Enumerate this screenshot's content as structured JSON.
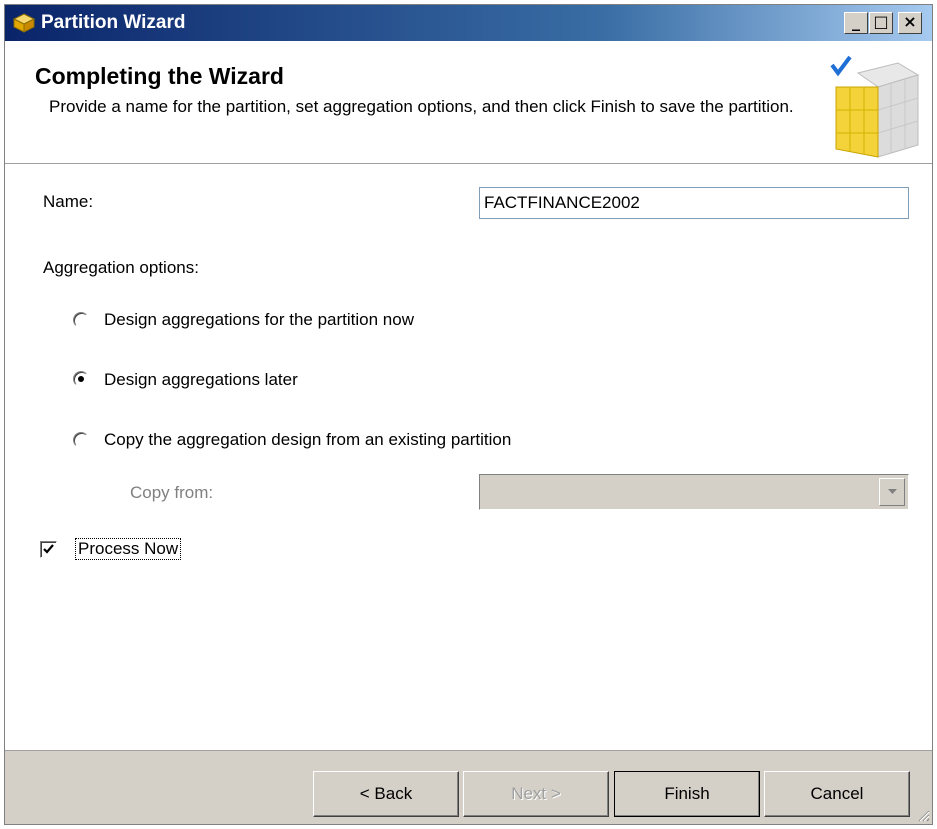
{
  "window": {
    "title": "Partition Wizard",
    "icon": "cube-wizard-icon",
    "controls": {
      "minimize": "_",
      "maximize": "□",
      "close": "×"
    }
  },
  "header": {
    "title": "Completing the Wizard",
    "description": "Provide a name for the partition, set aggregation options, and then click Finish to save the partition.",
    "graphic": "cube-check-graphic"
  },
  "form": {
    "name_label": "Name:",
    "name_value": "FACTFINANCE2002",
    "aggregation_label": "Aggregation options:",
    "options": [
      {
        "label": "Design aggregations for the partition now",
        "selected": false
      },
      {
        "label": "Design aggregations later",
        "selected": true
      },
      {
        "label": "Copy the aggregation design from an existing partition",
        "selected": false
      }
    ],
    "copy_from_label": "Copy from:",
    "copy_from_value": "",
    "process_now_label": "Process Now",
    "process_now_checked": true
  },
  "footer": {
    "back_label": "< Back",
    "next_label": "Next >",
    "finish_label": "Finish",
    "cancel_label": "Cancel"
  },
  "colors": {
    "title_bar_start": "#0a246a",
    "title_bar_end": "#a6caf0",
    "dialog_face": "#d4d0c8",
    "disabled_text": "#808080"
  }
}
